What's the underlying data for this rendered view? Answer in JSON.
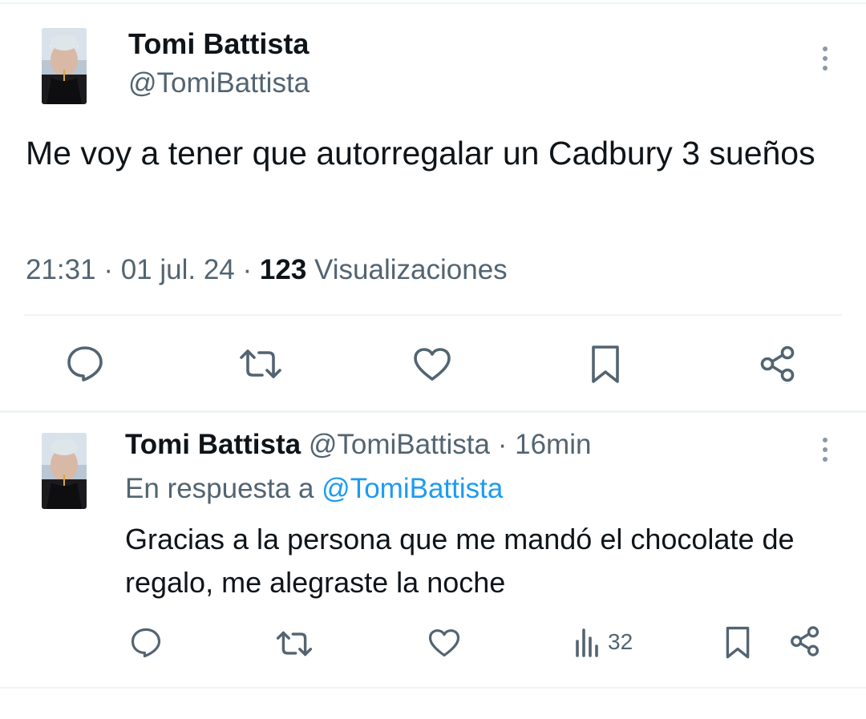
{
  "main_tweet": {
    "author_name": "Tomi Battista",
    "author_handle": "@TomiBattista",
    "text": "Me voy a tener que autorregalar un Cadbury 3 sueños",
    "time": "21:31",
    "separator": "·",
    "date": "01 jul. 24",
    "views_count": "123",
    "views_label": "Visualizaciones",
    "actions": [
      "reply-icon",
      "retweet-icon",
      "like-icon",
      "bookmark-icon",
      "share-icon"
    ]
  },
  "reply_tweet": {
    "author_name": "Tomi Battista",
    "author_handle": "@TomiBattista",
    "separator": "·",
    "time_ago": "16min",
    "replying_to_label": "En respuesta a",
    "replying_to_handle": "@TomiBattista",
    "text": "Gracias a la persona que me mandó el chocolate de regalo, me alegraste la noche",
    "views_count": "32",
    "actions": [
      "reply-icon",
      "retweet-icon",
      "like-icon",
      "views-icon",
      "bookmark-icon",
      "share-icon"
    ]
  },
  "colors": {
    "text_primary": "#0f1419",
    "text_secondary": "#536471",
    "link": "#1d9bf0",
    "divider": "#eff3f4"
  }
}
